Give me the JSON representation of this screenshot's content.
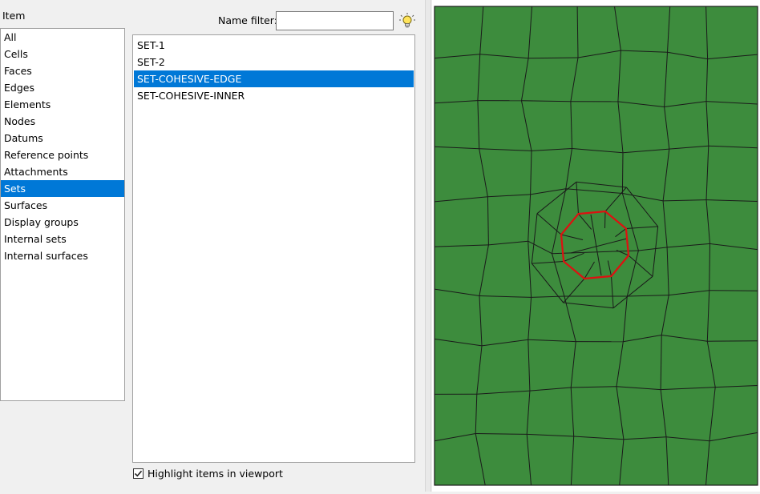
{
  "item_panel": {
    "header": "Item",
    "items": [
      {
        "label": "All",
        "selected": false
      },
      {
        "label": "Cells",
        "selected": false
      },
      {
        "label": "Faces",
        "selected": false
      },
      {
        "label": "Edges",
        "selected": false
      },
      {
        "label": "Elements",
        "selected": false
      },
      {
        "label": "Nodes",
        "selected": false
      },
      {
        "label": "Datums",
        "selected": false
      },
      {
        "label": "Reference points",
        "selected": false
      },
      {
        "label": "Attachments",
        "selected": false
      },
      {
        "label": "Sets",
        "selected": true
      },
      {
        "label": "Surfaces",
        "selected": false
      },
      {
        "label": "Display groups",
        "selected": false
      },
      {
        "label": "Internal sets",
        "selected": false
      },
      {
        "label": "Internal surfaces",
        "selected": false
      }
    ]
  },
  "filter": {
    "label": "Name filter:",
    "value": "",
    "placeholder": "",
    "icon": "lightbulb-icon"
  },
  "sets": [
    {
      "label": "SET-1",
      "selected": false
    },
    {
      "label": "SET-2",
      "selected": false
    },
    {
      "label": "SET-COHESIVE-EDGE",
      "selected": true
    },
    {
      "label": "SET-COHESIVE-INNER",
      "selected": false
    }
  ],
  "highlight": {
    "label": "Highlight items in viewport",
    "checked": true
  },
  "viewport": {
    "mesh_fill": "#3d8c3d",
    "mesh_line": "#1a1a1a",
    "highlight_color": "#dd1111"
  }
}
